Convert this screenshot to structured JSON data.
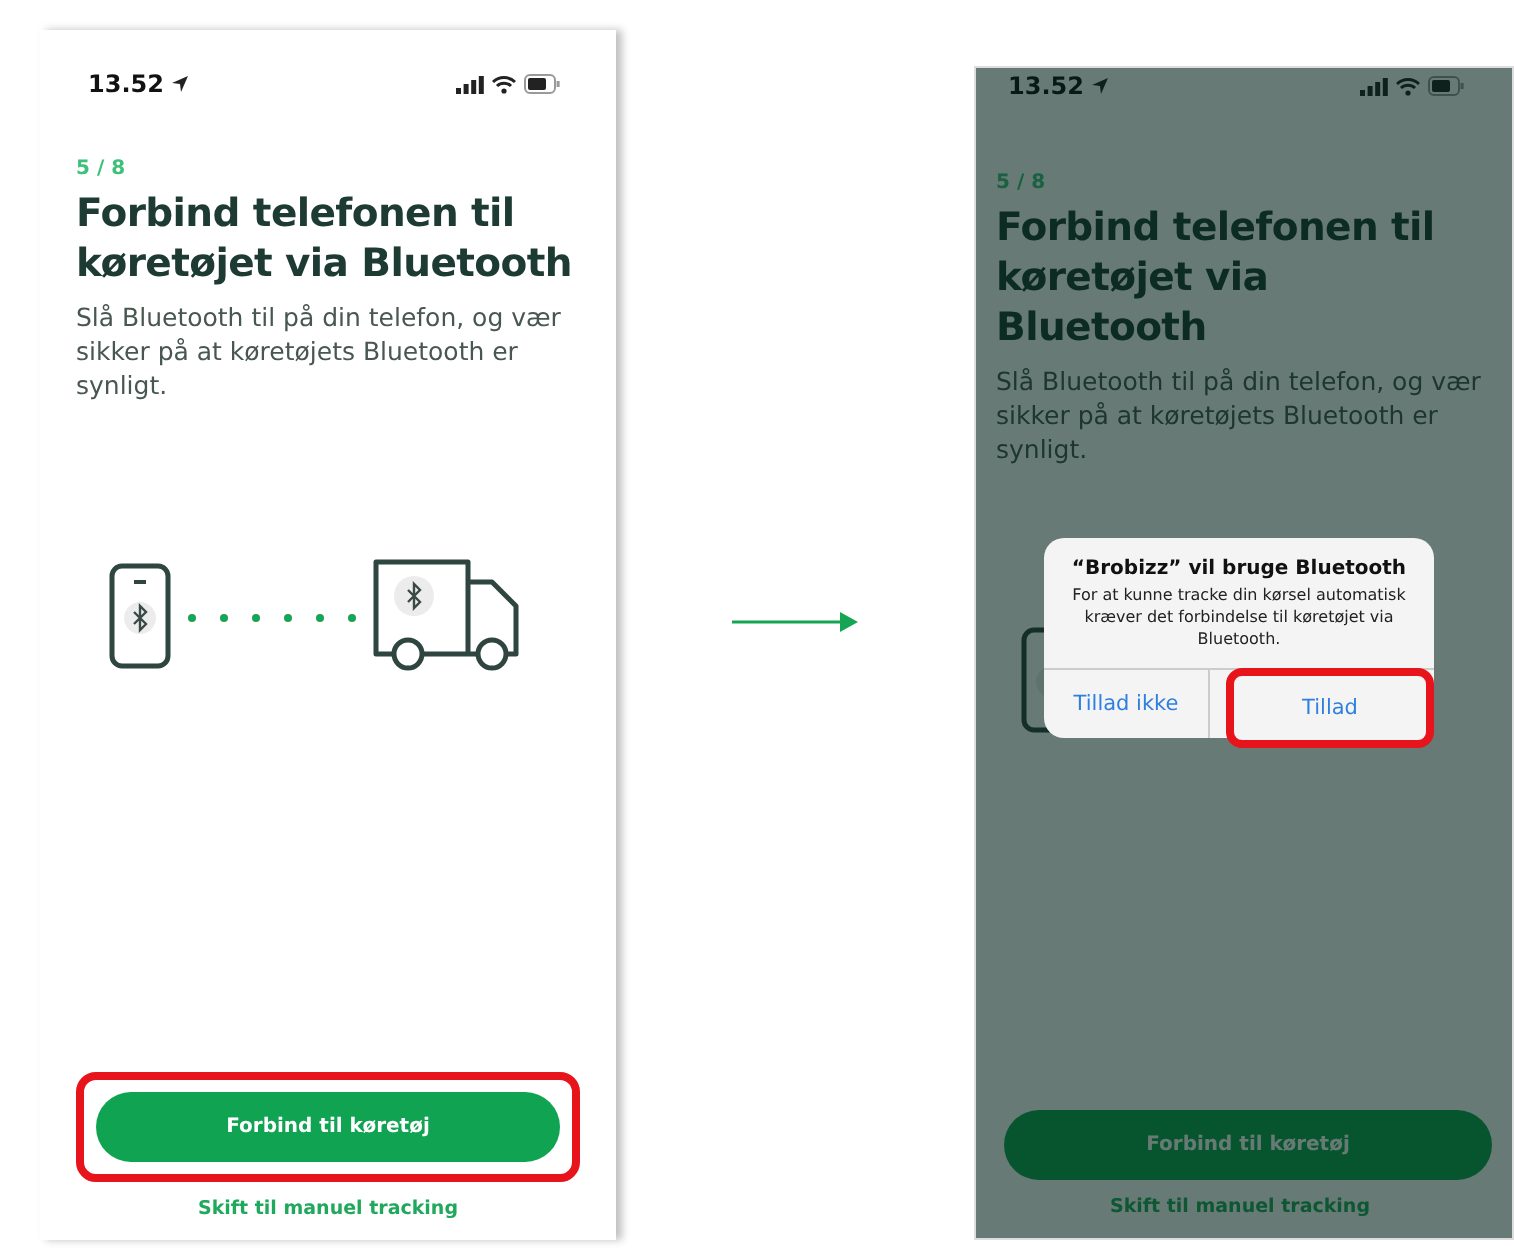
{
  "screens": [
    {
      "dimmed": false,
      "status_time": "13.52",
      "step": "5 / 8",
      "title": "Forbind telefonen til køretøjet via Bluetooth",
      "body": "Slå Bluetooth til på din telefon, og vær sikker på at køretøjets Bluetooth er synligt.",
      "primary_button": {
        "label": "Forbind til køretøj",
        "highlighted": true
      },
      "link": "Skift til manuel tracking"
    },
    {
      "dimmed": true,
      "status_time": "13.52",
      "step": "5 / 8",
      "title": "Forbind telefonen til køretøjet via Bluetooth",
      "body": "Slå Bluetooth til på din telefon, og vær sikker på at køretøjets Bluetooth er synligt.",
      "primary_button": {
        "label": "Forbind til køretøj",
        "highlighted": false
      },
      "link": "Skift til manuel tracking",
      "dialog": {
        "title": "“Brobizz” vil bruge Bluetooth",
        "message": "For at kunne tracke din kørsel automatisk kræver det forbindelse til køretøjet via Bluetooth.",
        "buttons": [
          {
            "label": "Tillad ikke",
            "highlighted": false
          },
          {
            "label": "Tillad",
            "highlighted": true
          }
        ]
      }
    }
  ]
}
